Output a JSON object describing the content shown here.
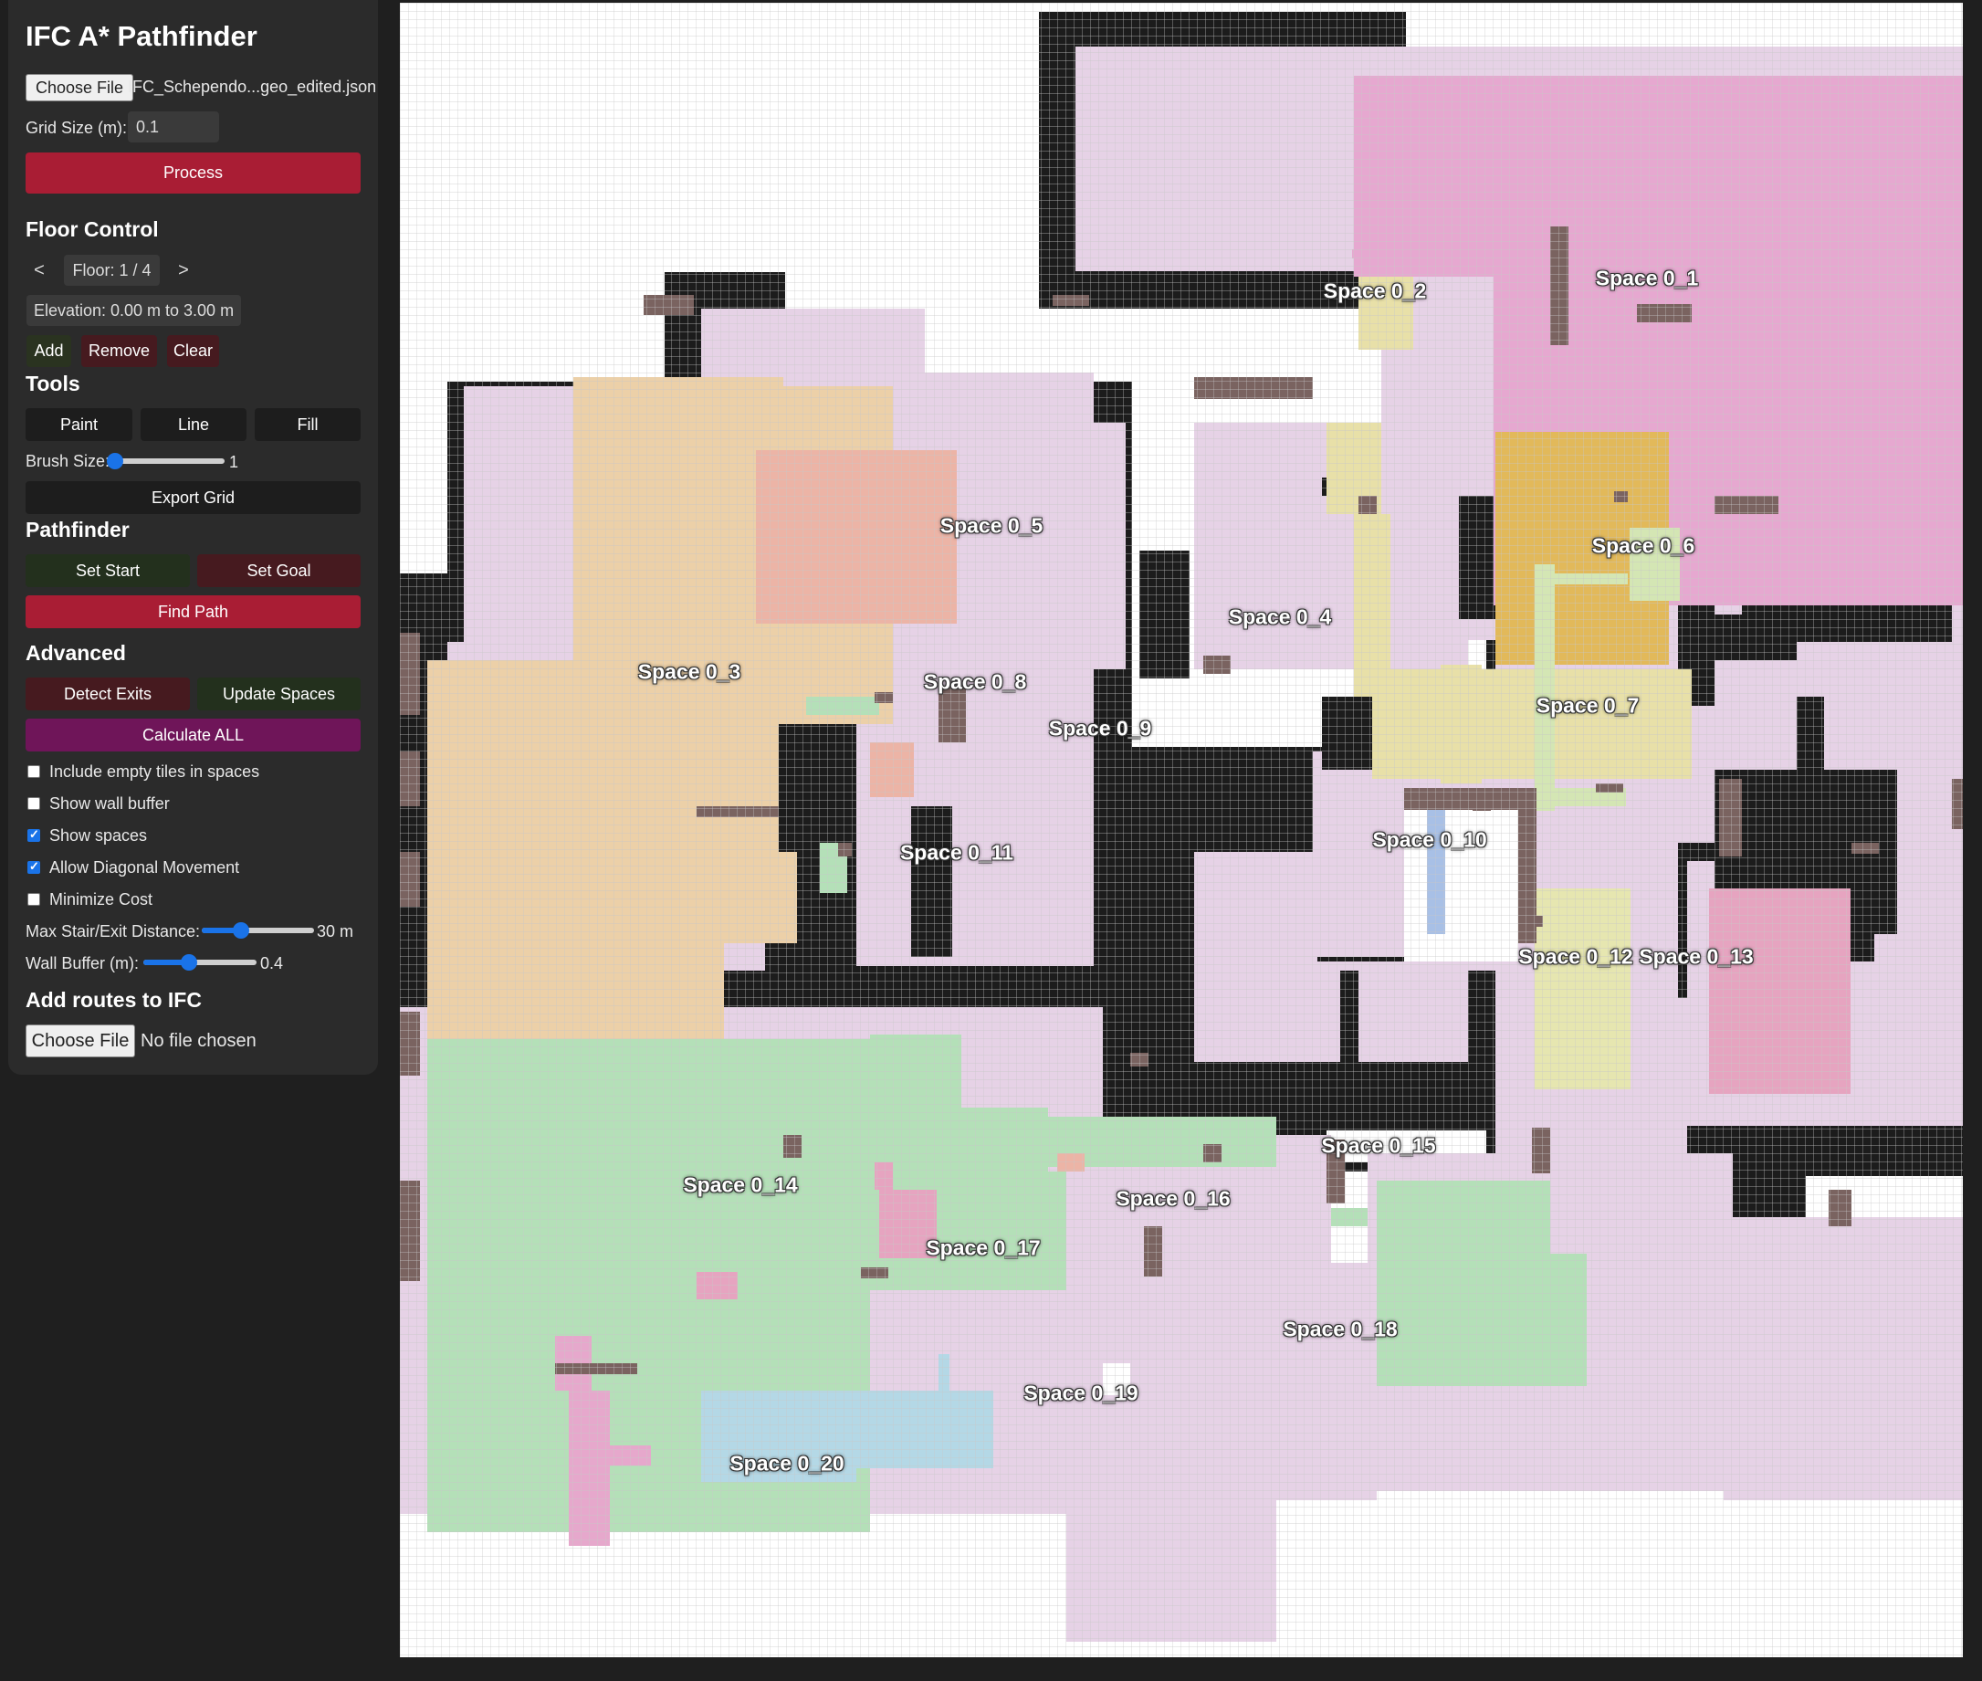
{
  "sidebar": {
    "title": "IFC A* Pathfinder",
    "file": {
      "button": "Choose File",
      "name": "IFC_Schependo...geo_edited.json"
    },
    "grid_size": {
      "label": "Grid Size (m):",
      "value": "0.1"
    },
    "process_label": "Process",
    "floor_control": {
      "heading": "Floor Control",
      "prev": "<",
      "next": ">",
      "floor_text": "Floor: 1 / 4",
      "elevation": "Elevation: 0.00 m to 3.00 m",
      "add": "Add",
      "remove": "Remove",
      "clear": "Clear"
    },
    "tools": {
      "heading": "Tools",
      "paint": "Paint",
      "line": "Line",
      "fill": "Fill",
      "brush_label": "Brush Size:",
      "brush_value": "1",
      "brush_fraction": 0.0,
      "export": "Export Grid"
    },
    "pathfinder": {
      "heading": "Pathfinder",
      "set_start": "Set Start",
      "set_goal": "Set Goal",
      "find_path": "Find Path"
    },
    "advanced": {
      "heading": "Advanced",
      "detect_exits": "Detect Exits",
      "update_spaces": "Update Spaces",
      "calculate_all": "Calculate ALL",
      "options": [
        {
          "label": "Include empty tiles in spaces",
          "checked": false
        },
        {
          "label": "Show wall buffer",
          "checked": false
        },
        {
          "label": "Show spaces",
          "checked": true
        },
        {
          "label": "Allow Diagonal Movement",
          "checked": true
        },
        {
          "label": "Minimize Cost",
          "checked": false
        }
      ],
      "max_stair": {
        "label": "Max Stair/Exit Distance:",
        "value": "30 m",
        "fraction": 0.35
      },
      "wall_buffer": {
        "label": "Wall Buffer (m):",
        "value": "0.4",
        "fraction": 0.4
      }
    },
    "routes": {
      "heading": "Add routes to IFC",
      "button": "Choose File",
      "status": "No file chosen"
    }
  },
  "canvas": {
    "spaces": [
      {
        "name": "Space 0_1"
      },
      {
        "name": "Space 0_2"
      },
      {
        "name": "Space 0_3"
      },
      {
        "name": "Space 0_4"
      },
      {
        "name": "Space 0_5"
      },
      {
        "name": "Space 0_6"
      },
      {
        "name": "Space 0_7"
      },
      {
        "name": "Space 0_8"
      },
      {
        "name": "Space 0_9"
      },
      {
        "name": "Space 0_10"
      },
      {
        "name": "Space 0_11"
      },
      {
        "name": "Space 0_12"
      },
      {
        "name": "Space 0_13"
      },
      {
        "name": "Space 0_14"
      },
      {
        "name": "Space 0_15"
      },
      {
        "name": "Space 0_16"
      },
      {
        "name": "Space 0_17"
      },
      {
        "name": "Space 0_18"
      },
      {
        "name": "Space 0_19"
      },
      {
        "name": "Space 0_20"
      }
    ],
    "colors": {
      "wall": "#1c1c1c",
      "buffer": "#e6d2e6",
      "door": "#7a6360",
      "space_0_1": "#e6a8d0",
      "space_0_3": "#ecd0a8",
      "space_0_4": "#e8e0a8",
      "space_0_4_fill": "#e2b95a",
      "space_0_5": "#ecb4a6",
      "space_0_7": "#d4e6b4",
      "space_0_10": "#a8c0e6",
      "space_0_12": "#e6e6b0",
      "space_0_13": "#e6a4c0",
      "space_0_14": "#b4e0b8",
      "space_0_18": "#b4e0b8",
      "space_0_19": "#b4d8e6",
      "space_0_20": "#e6a8cc"
    }
  }
}
